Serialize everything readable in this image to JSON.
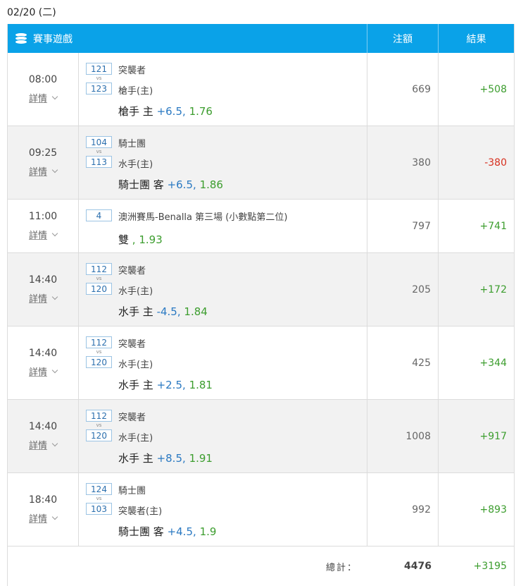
{
  "date": "02/20 (二)",
  "header": {
    "game_label": "賽事遊戲",
    "bet_label": "注額",
    "result_label": "結果",
    "icon": "coins-stack-icon"
  },
  "details_label": "詳情",
  "vs": "vs",
  "rows": [
    {
      "time": "08:00",
      "id_a": "121",
      "id_b": "123",
      "team_a": "突襲者",
      "team_b": "槍手(主)",
      "pick_team": "槍手 主",
      "pick_handicap": "+6.5",
      "pick_sep": ",",
      "pick_odds": "1.76",
      "bet": "669",
      "result": "+508",
      "result_sign": "positive"
    },
    {
      "time": "09:25",
      "id_a": "104",
      "id_b": "113",
      "team_a": "騎士團",
      "team_b": "水手(主)",
      "pick_team": "騎士團 客",
      "pick_handicap": "+6.5",
      "pick_sep": ",",
      "pick_odds": "1.86",
      "bet": "380",
      "result": "-380",
      "result_sign": "negative"
    },
    {
      "time": "11:00",
      "id_a": "4",
      "team_a": "澳洲賽馬-Benalla 第三場 (小數點第二位)",
      "pick_team": "雙",
      "pick_sep": ",",
      "pick_odds": "1.93",
      "bet": "797",
      "result": "+741",
      "result_sign": "positive"
    },
    {
      "time": "14:40",
      "id_a": "112",
      "id_b": "120",
      "team_a": "突襲者",
      "team_b": "水手(主)",
      "pick_team": "水手 主",
      "pick_handicap": "-4.5",
      "pick_sep": ",",
      "pick_odds": "1.84",
      "bet": "205",
      "result": "+172",
      "result_sign": "positive"
    },
    {
      "time": "14:40",
      "id_a": "112",
      "id_b": "120",
      "team_a": "突襲者",
      "team_b": "水手(主)",
      "pick_team": "水手 主",
      "pick_handicap": "+2.5",
      "pick_sep": ",",
      "pick_odds": "1.81",
      "bet": "425",
      "result": "+344",
      "result_sign": "positive"
    },
    {
      "time": "14:40",
      "id_a": "112",
      "id_b": "120",
      "team_a": "突襲者",
      "team_b": "水手(主)",
      "pick_team": "水手 主",
      "pick_handicap": "+8.5",
      "pick_sep": ",",
      "pick_odds": "1.91",
      "bet": "1008",
      "result": "+917",
      "result_sign": "positive"
    },
    {
      "time": "18:40",
      "id_a": "124",
      "id_b": "103",
      "team_a": "騎士團",
      "team_b": "突襲者(主)",
      "pick_team": "騎士團 客",
      "pick_handicap": "+4.5",
      "pick_sep": ",",
      "pick_odds": "1.9",
      "bet": "992",
      "result": "+893",
      "result_sign": "positive"
    }
  ],
  "total": {
    "label": "總計：",
    "bet": "4476",
    "result": "+3195"
  },
  "colors": {
    "header_bg": "#0aa2e8",
    "positive": "#3c9d2e",
    "negative": "#d7301f",
    "handicap": "#2a79c2"
  }
}
